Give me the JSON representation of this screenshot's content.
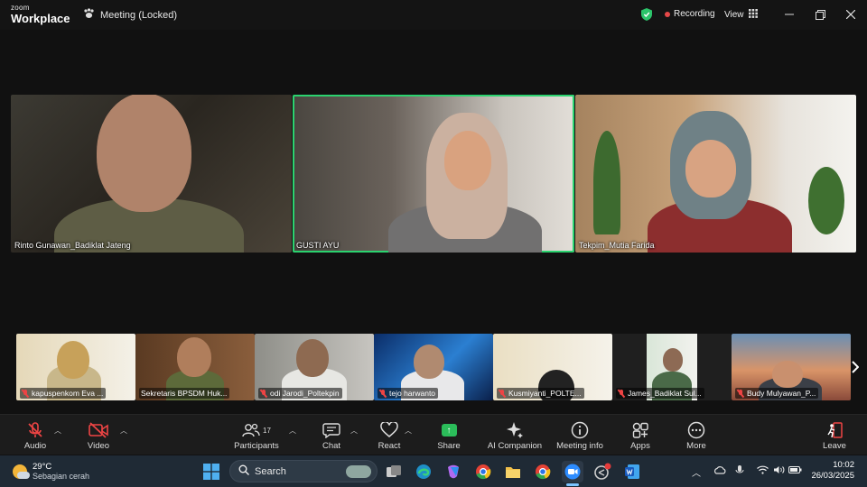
{
  "app": {
    "brand_line1": "zoom",
    "brand_line2": "Workplace",
    "meeting_title": "Meeting (Locked)",
    "recording_label": "Recording",
    "view_label": "View"
  },
  "speaker_tiles": [
    {
      "name": "Rinto Gunawan_Badiklat Jateng"
    },
    {
      "name": "GUSTI AYU",
      "active_speaker": true
    },
    {
      "name": "Tekpim_Mutia Farida"
    }
  ],
  "gallery_strip": [
    {
      "name": "kapuspenkom Eva ..."
    },
    {
      "name": "Sekretaris BPSDM Huk..."
    },
    {
      "name": "odi Jarodi_Poltekpin"
    },
    {
      "name": "tejo harwanto"
    },
    {
      "name": "Kusmiyanti_POLTE..."
    },
    {
      "name": "James_Badiklat Sul..."
    },
    {
      "name": "Budy Mulyawan_P..."
    }
  ],
  "toolbar": {
    "audio": "Audio",
    "video": "Video",
    "participants": "Participants",
    "participants_count": "17",
    "chat": "Chat",
    "react": "React",
    "share": "Share",
    "ai_companion": "AI Companion",
    "meeting_info": "Meeting info",
    "apps": "Apps",
    "more": "More",
    "leave": "Leave"
  },
  "taskbar": {
    "temperature": "29°C",
    "weather_desc": "Sebagian cerah",
    "search_label": "Search",
    "time": "10:02",
    "date": "26/03/2025"
  },
  "colors": {
    "active_speaker_border": "#2bd36f",
    "recording_dot": "#e64848",
    "share_green": "#2bbd5a",
    "muted_red": "#e44444"
  }
}
